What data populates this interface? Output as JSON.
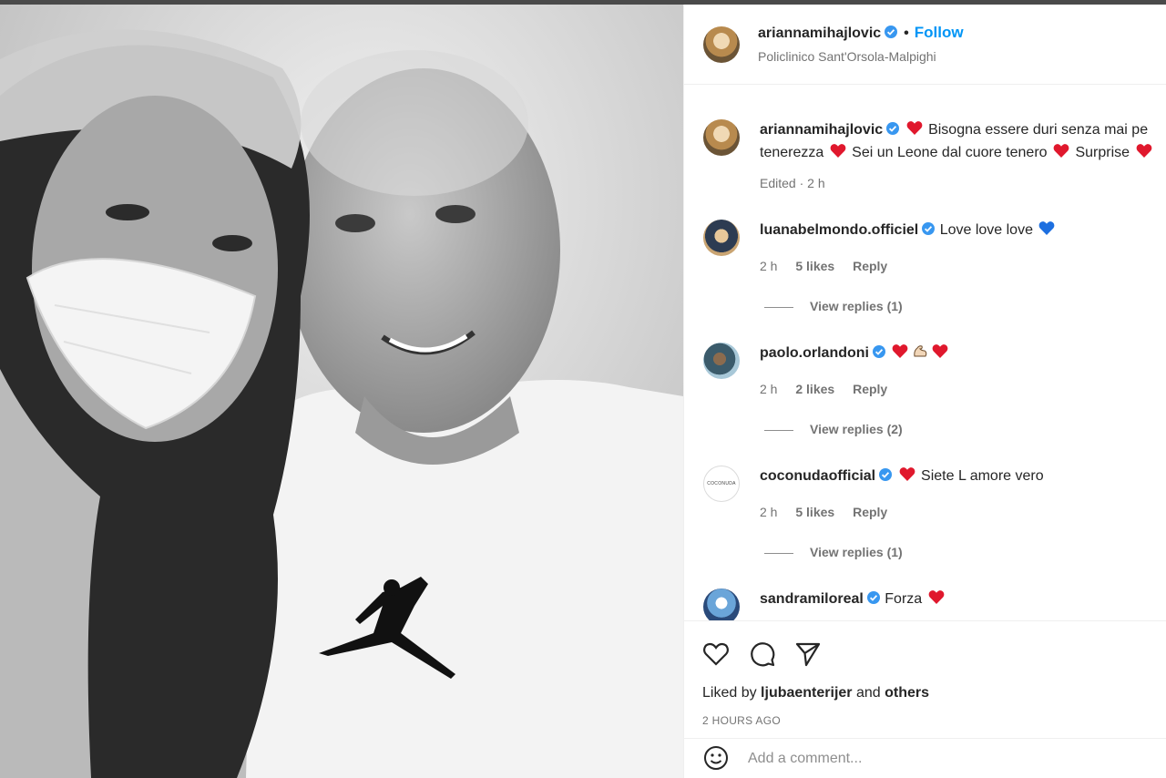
{
  "header": {
    "username": "ariannamihajlovic",
    "separator": "•",
    "follow_label": "Follow",
    "location": "Policlinico Sant'Orsola-Malpighi"
  },
  "caption": {
    "username": "ariannamihajlovic",
    "line1_text": "Bisogna essere duri senza mai pe",
    "line2_part1": "tenerezza",
    "line2_part2": "Sei un Leone dal cuore tenero",
    "line2_part3": "Surprise",
    "edited": "Edited · 2 h"
  },
  "comments": [
    {
      "username": "luanabelmondo.officiel",
      "text": "Love love love",
      "time": "2 h",
      "likes": "5 likes",
      "reply": "Reply",
      "view_replies": "View replies (1)"
    },
    {
      "username": "paolo.orlandoni",
      "text": "",
      "time": "2 h",
      "likes": "2 likes",
      "reply": "Reply",
      "view_replies": "View replies (2)"
    },
    {
      "username": "coconudaofficial",
      "text": "Siete L amore vero",
      "time": "2 h",
      "likes": "5 likes",
      "reply": "Reply",
      "view_replies": "View replies (1)",
      "avatar_text": "COCONUDA"
    },
    {
      "username": "sandramiloreal",
      "text": "Forza"
    }
  ],
  "footer": {
    "liked_prefix": "Liked by",
    "liked_user": "ljubaenterijer",
    "liked_and": "and",
    "liked_others": "others",
    "time_ago": "2 HOURS AGO",
    "comment_placeholder": "Add a comment..."
  },
  "icons": {
    "like": "heart-outline-icon",
    "comment": "comment-bubble-icon",
    "share": "paper-plane-icon",
    "emoji": "smiley-face-icon",
    "verified": "verified-badge-icon"
  },
  "colors": {
    "accent": "#0095f6",
    "verified": "#3897f0",
    "heart": "#e0182d",
    "muted": "#737373"
  }
}
